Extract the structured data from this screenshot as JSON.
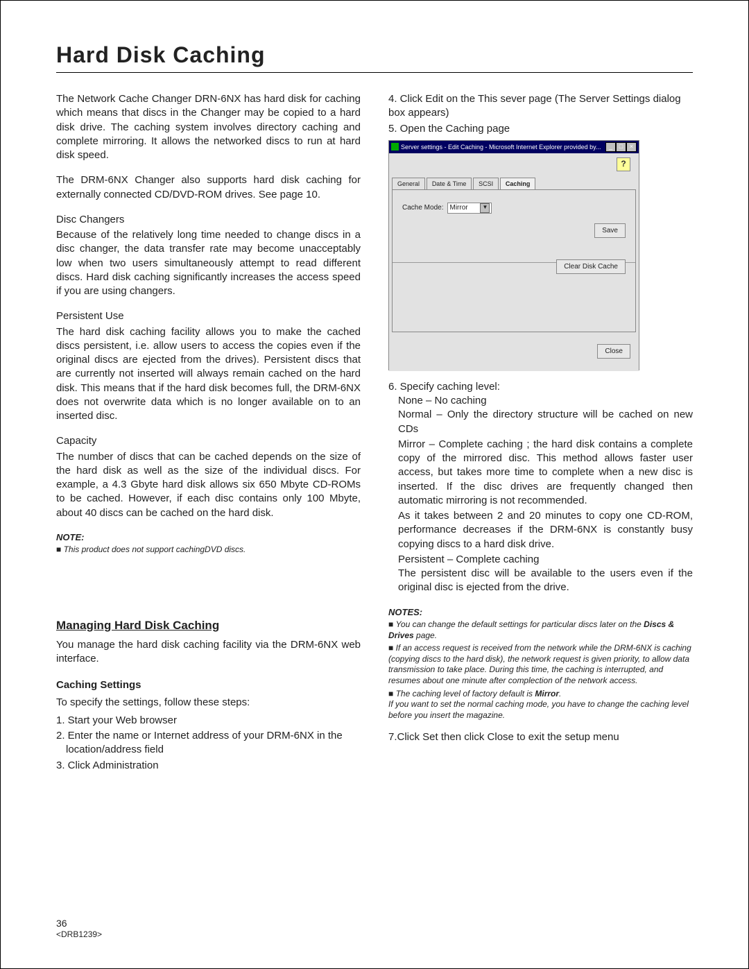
{
  "title": "Hard Disk Caching",
  "left": {
    "p1": "The Network Cache Changer DRN-6NX has hard disk for caching which means that discs in the Changer may be copied to a hard disk drive.  The caching system involves directory caching and complete mirroring. It allows the networked discs to run at hard disk speed.",
    "p2": "The DRM-6NX Changer also supports hard disk caching for externally connected CD/DVD-ROM drives. See page 10.",
    "h1": "Disc Changers",
    "p3": "Because of the relatively long time needed to change discs in a disc changer, the data transfer rate may become unacceptably low when two users simultaneously attempt to read different discs. Hard disk caching significantly increases the access speed if you are using changers.",
    "h2": "Persistent Use",
    "p4": "The hard disk caching facility allows you to make the cached discs persistent, i.e. allow users to access the copies even if the original discs are ejected from the drives). Persistent discs that are currently not inserted will always remain cached on the hard disk. This means that if the hard disk becomes full, the DRM-6NX does not overwrite data which is no longer available on to an inserted disc.",
    "h3": "Capacity",
    "p5": "The number of discs that can be cached depends on the size of the hard disk as well as the size of the individual discs. For example, a 4.3 Gbyte hard disk allows six 650 Mbyte CD-ROMs to be cached. However, if each disc contains only 100 Mbyte, about 40 discs can be cached on the hard disk.",
    "noteHead": "NOTE:",
    "note1": "This product does not support cachingDVD discs.",
    "mg": "Managing Hard Disk Caching",
    "mgText": "You manage the hard disk caching facility via the DRM-6NX web interface.",
    "csHead": "Caching Settings",
    "csText": "To specify the settings, follow these steps:",
    "steps": {
      "s1": "1. Start your Web browser",
      "s2": "2. Enter the name or Internet address of your DRM-6NX in the location/address field",
      "s3": "3. Click Administration"
    }
  },
  "right": {
    "s4": "4. Click Edit on the This sever page (The Server Settings dialog box appears)",
    "s5": "5. Open the Caching page",
    "shot": {
      "title": "Server settings - Edit Caching - Microsoft Internet Explorer provided by...",
      "tabs": {
        "t1": "General",
        "t2": "Date & Time",
        "t3": "SCSI",
        "t4": "Caching"
      },
      "cacheModeLabel": "Cache Mode:",
      "cacheModeValue": "Mirror",
      "save": "Save",
      "clear": "Clear Disk Cache",
      "close": "Close"
    },
    "s6": "6. Specify caching level:",
    "lvNone": "None – No caching",
    "lvNormal": "Normal – Only the directory structure will be cached on new CDs",
    "lvMirror": "Mirror – Complete caching ; the  hard disk contains a complete copy of the mirrored disc. This method allows faster user access, but takes more time to complete when a new disc is inserted.  If the disc drives are frequently changed then automatic mirroring is not recommended.",
    "lvMirror2": "As it takes between 2 and 20 minutes to copy one CD-ROM, performance decreases if the DRM-6NX is constantly busy copying discs to a hard disk drive.",
    "lvPers": "Persistent – Complete caching",
    "lvPers2": "The persistent disc will be available to the users even if the original disc is ejected from the drive.",
    "notesHead": "NOTES:",
    "n1a": "You can change the default settings for particular discs later on the ",
    "n1b": "Discs & Drives",
    "n1c": " page.",
    "n2": "If an access request is received from the network while the DRM-6NX is caching (copying discs to the hard disk), the network request is given priority, to allow data transmission to take place. During this time, the caching is interrupted, and resumes about one minute after complection of the network access.",
    "n3a": "The caching level of factory default is ",
    "n3b": "Mirror",
    "n3c": ".",
    "n3d": "If you want to set the normal caching mode, you have to change the caching level before you insert the magazine.",
    "s7": "7.Click Set then click Close to exit the setup menu"
  },
  "footer": {
    "pageNum": "36",
    "docId": "<DRB1239>"
  }
}
